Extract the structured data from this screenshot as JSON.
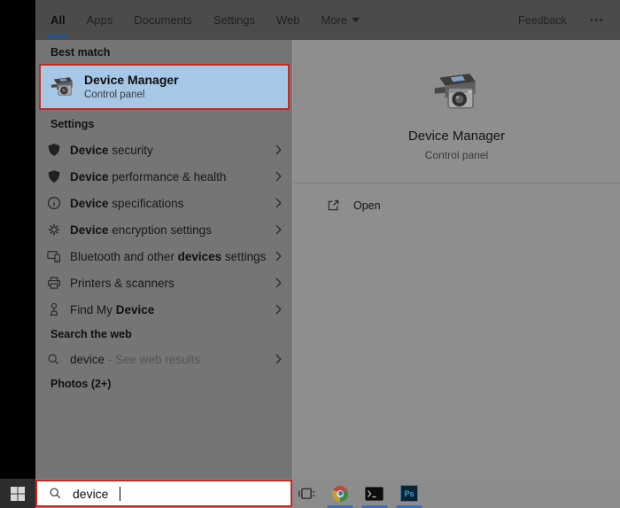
{
  "topbar": {
    "tabs": [
      "All",
      "Apps",
      "Documents",
      "Settings",
      "Web",
      "More"
    ],
    "active_tab": "All",
    "feedback": "Feedback",
    "overflow": "•••"
  },
  "best_match": {
    "header": "Best match",
    "title": "Device Manager",
    "subtitle": "Control panel",
    "icon": "device-manager-icon"
  },
  "settings": {
    "header": "Settings",
    "items": [
      {
        "icon": "shield-icon",
        "seg0": "",
        "seg1": "Device",
        "seg2": " security"
      },
      {
        "icon": "shield-icon",
        "seg0": "",
        "seg1": "Device",
        "seg2": " performance & health"
      },
      {
        "icon": "info-icon",
        "seg0": "",
        "seg1": "Device",
        "seg2": " specifications"
      },
      {
        "icon": "gear-icon",
        "seg0": "",
        "seg1": "Device",
        "seg2": " encryption settings"
      },
      {
        "icon": "devices-icon",
        "seg0": "Bluetooth and other ",
        "seg1": "devices",
        "seg2": " settings"
      },
      {
        "icon": "printer-icon",
        "seg0": "Printers & scanners",
        "seg1": "",
        "seg2": ""
      },
      {
        "icon": "location-pin-icon",
        "seg0": "Find My ",
        "seg1": "Device",
        "seg2": ""
      }
    ]
  },
  "search_web": {
    "header": "Search the web",
    "icon": "search-icon",
    "query": "device",
    "suffix": " - See web results"
  },
  "photos": {
    "header": "Photos (2+)"
  },
  "preview": {
    "icon": "device-manager-icon-large",
    "title": "Device Manager",
    "subtitle": "Control panel",
    "open_label": "Open",
    "open_icon": "open-external-icon"
  },
  "taskbar": {
    "start_icon": "windows-logo-icon",
    "search": {
      "icon": "search-icon",
      "value": "device"
    },
    "icons": [
      "task-view-icon",
      "chrome-icon",
      "terminal-icon",
      "photoshop-icon"
    ],
    "photoshop_label": "Ps"
  },
  "colors": {
    "annotation_red": "#c9281f",
    "selection_blue": "#a7c7e7",
    "tab_underline_blue": "#26578c",
    "running_indicator_blue": "#3a6fc2",
    "left_panel_gray": "#757575",
    "right_panel_gray": "#8e8e8e",
    "topbar_gray": "#4b4b4b"
  }
}
